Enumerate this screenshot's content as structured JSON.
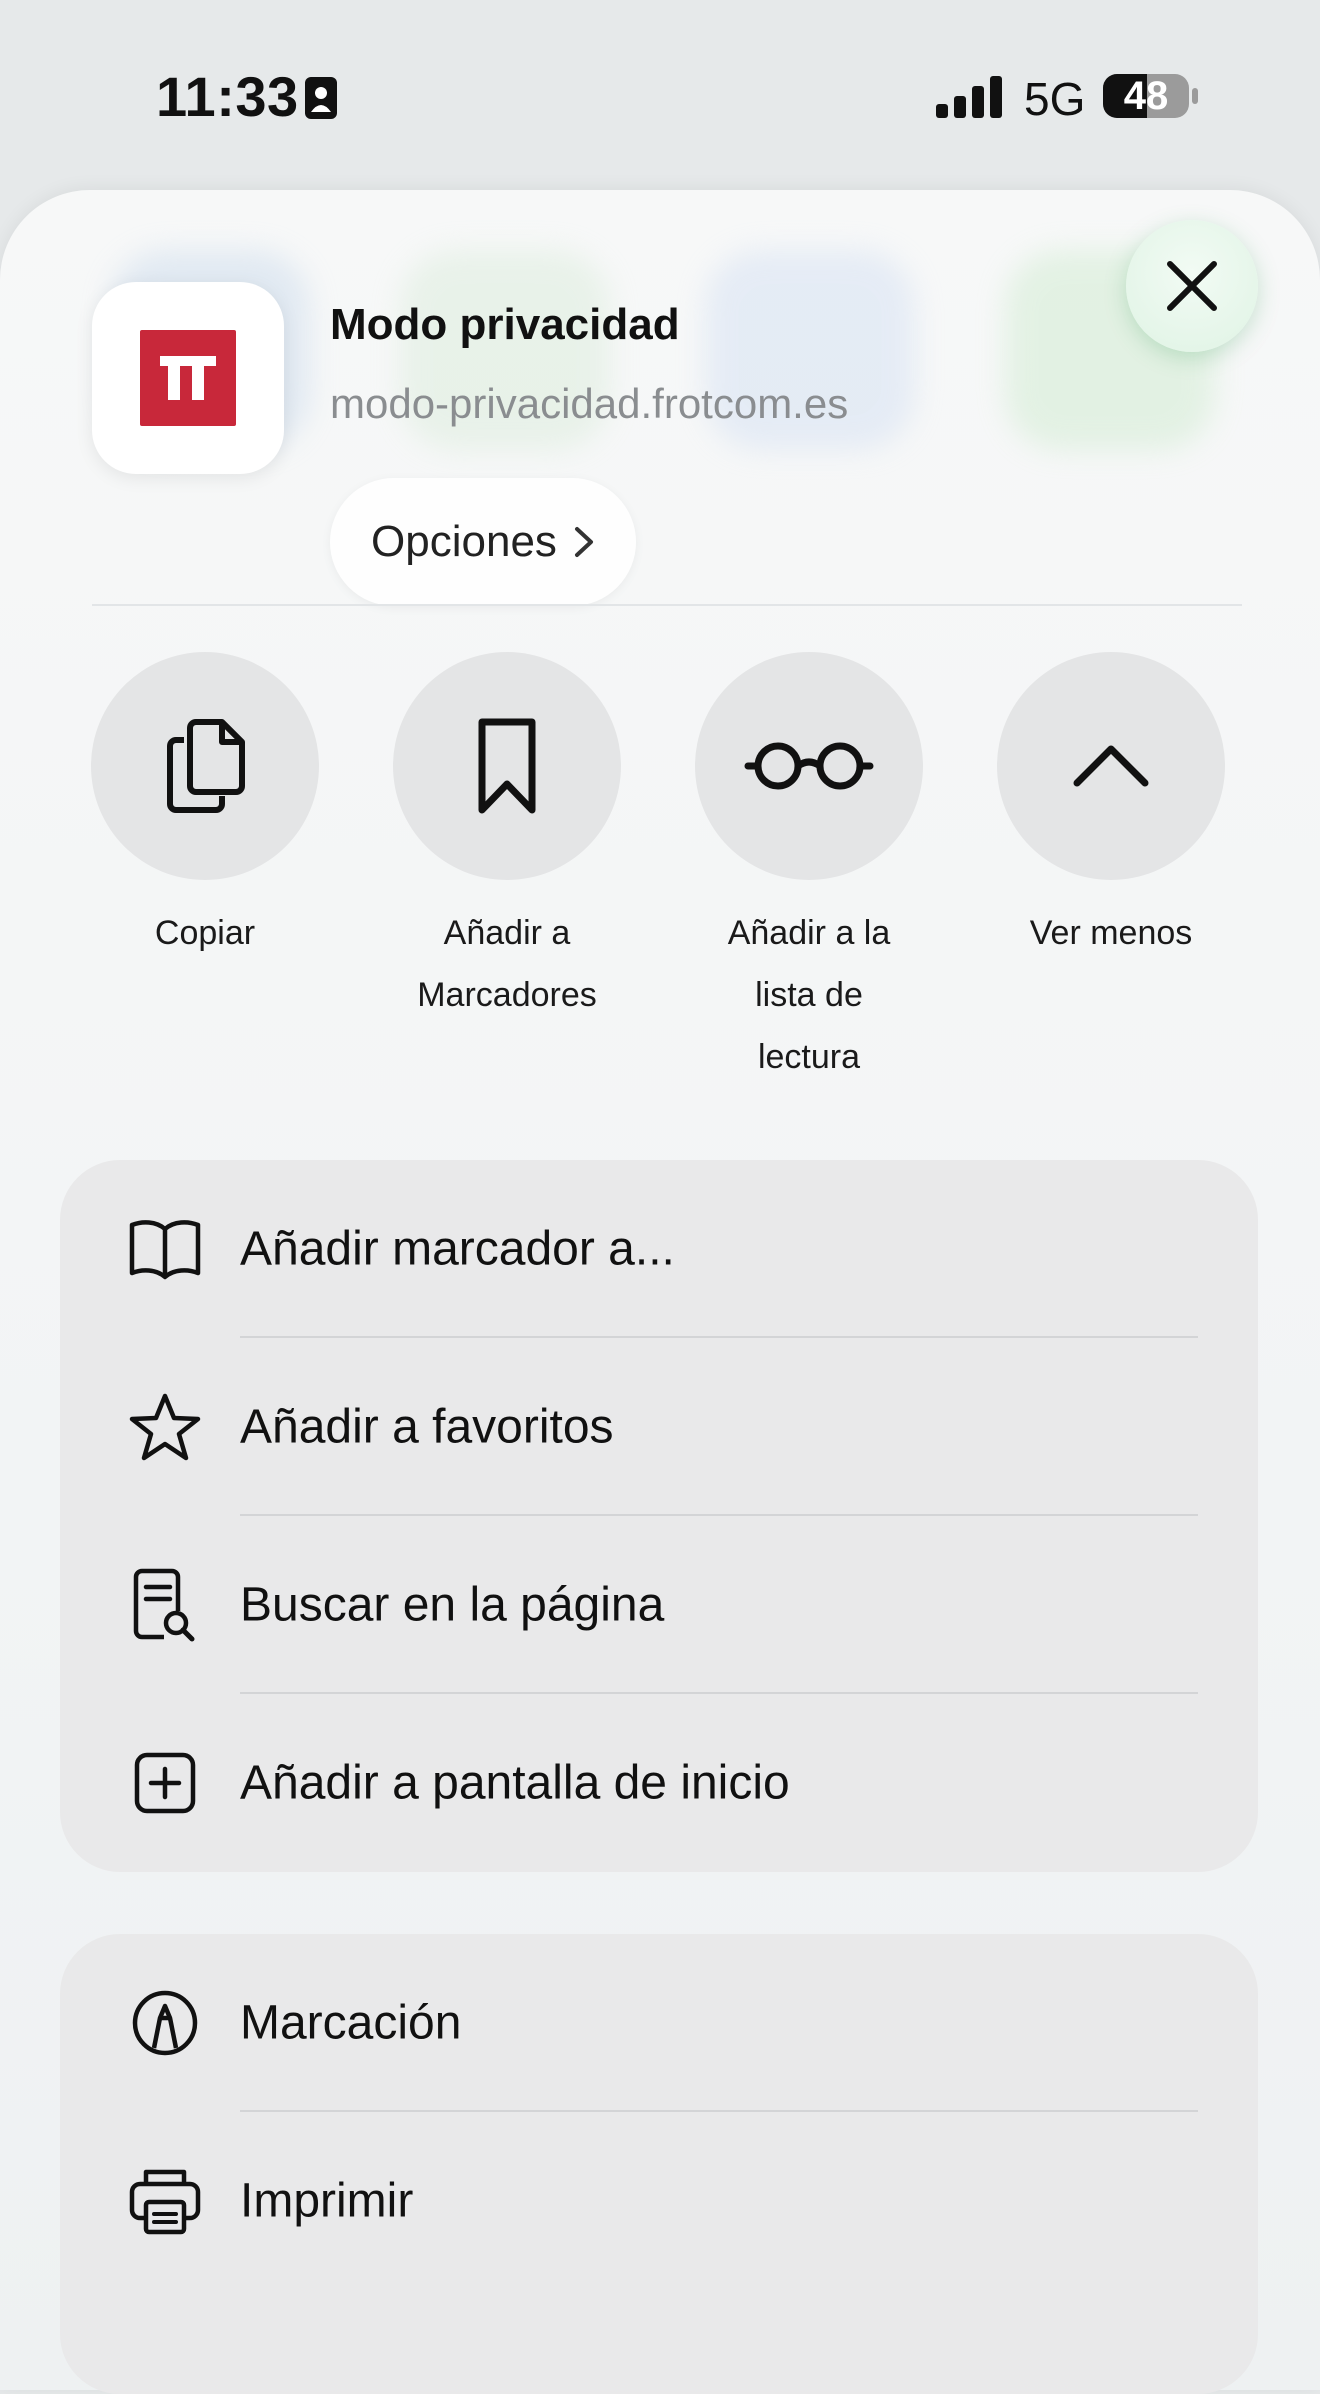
{
  "status_bar": {
    "time": "11:33",
    "network": "5G",
    "battery": "48"
  },
  "site": {
    "title": "Modo privacidad",
    "url": "modo-privacidad.frotcom.es",
    "options_label": "Opciones",
    "brand_color": "#c8283a"
  },
  "actions": [
    {
      "label_lines": [
        "Copiar"
      ],
      "icon": "copy-icon"
    },
    {
      "label_lines": [
        "Añadir a",
        "Marcadores"
      ],
      "icon": "bookmark-icon"
    },
    {
      "label_lines": [
        "Añadir a la",
        "lista de",
        "lectura"
      ],
      "icon": "glasses-icon"
    },
    {
      "label_lines": [
        "Ver menos"
      ],
      "icon": "chevron-up-icon"
    }
  ],
  "menu_group_1": [
    {
      "label": "Añadir marcador a...",
      "icon": "book-icon"
    },
    {
      "label": "Añadir a favoritos",
      "icon": "star-icon"
    },
    {
      "label": "Buscar en la página",
      "icon": "find-in-page-icon"
    },
    {
      "label": "Añadir a pantalla de inicio",
      "icon": "add-square-icon"
    }
  ],
  "menu_group_2": [
    {
      "label": "Marcación",
      "icon": "markup-icon"
    },
    {
      "label": "Imprimir",
      "icon": "printer-icon"
    }
  ]
}
